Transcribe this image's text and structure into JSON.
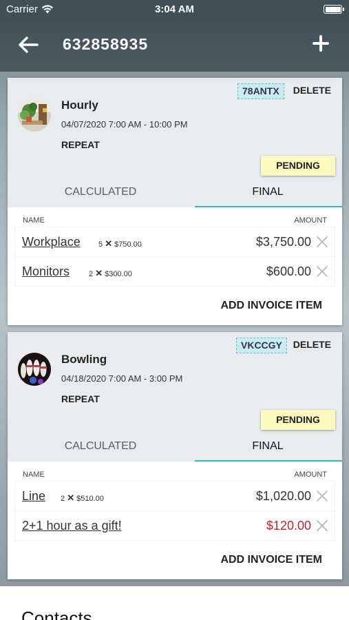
{
  "status_bar": {
    "carrier": "Carrier",
    "time": "3:04 AM"
  },
  "header": {
    "title": "632858935"
  },
  "cards": [
    {
      "code": "78ANTX",
      "delete_label": "DELETE",
      "title": "Hourly",
      "date": "04/07/2020 7:00 AM - 10:00 PM",
      "repeat": "REPEAT",
      "status": "PENDING",
      "tabs": [
        "CALCULATED",
        "FINAL"
      ],
      "active_tab": "FINAL",
      "columns": {
        "name": "NAME",
        "amount": "AMOUNT"
      },
      "items": [
        {
          "name": "Workplace",
          "qty": "5",
          "unit_price": "$750.00",
          "amount": "$3,750.00"
        },
        {
          "name": "Monitors",
          "qty": "2",
          "unit_price": "$300.00",
          "amount": "$600.00"
        }
      ],
      "add_item_label": "ADD INVOICE ITEM"
    },
    {
      "code": "VKCCGY",
      "delete_label": "DELETE",
      "title": "Bowling",
      "date": "04/18/2020 7:00 AM - 3:00 PM",
      "repeat": "REPEAT",
      "status": "PENDING",
      "tabs": [
        "CALCULATED",
        "FINAL"
      ],
      "active_tab": "FINAL",
      "columns": {
        "name": "NAME",
        "amount": "AMOUNT"
      },
      "items": [
        {
          "name": "Line",
          "qty": "2",
          "unit_price": "$510.00",
          "amount": "$1,020.00"
        },
        {
          "name": "2+1 hour as a gift!",
          "qty": "",
          "unit_price": "",
          "amount": "$120.00"
        }
      ],
      "add_item_label": "ADD INVOICE ITEM"
    }
  ],
  "contacts": {
    "heading": "Contacts"
  },
  "colors": {
    "accent": "#32b4cc",
    "pending_bg": "#fcf8c0",
    "code_bg": "#c9ecf3",
    "negative_amount": "#c2242a",
    "nav_bg": "#3f5058"
  },
  "icons": [
    "wifi-icon",
    "battery-icon",
    "back-arrow-icon",
    "plus-icon",
    "remove-x-icon",
    "multiply-icon"
  ]
}
